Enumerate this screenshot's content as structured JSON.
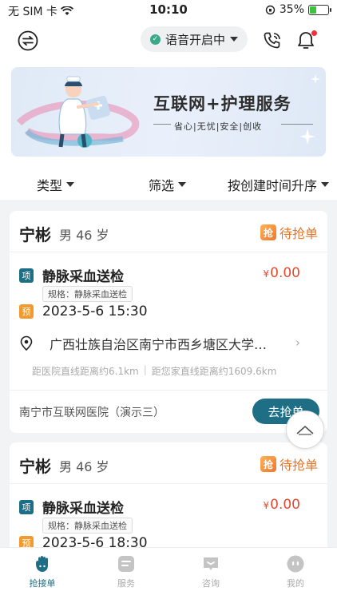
{
  "status_bar": {
    "carrier": "无 SIM 卡",
    "time": "10:10",
    "battery": "35%",
    "battery_fraction": 0.35
  },
  "header": {
    "voice_label": "语音开启中"
  },
  "banner": {
    "title": "互联网+护理服务",
    "subtitle": "省心|无忧|安全|创收"
  },
  "filters": [
    {
      "label": "类型"
    },
    {
      "label": "筛选"
    },
    {
      "label": "按创建时间升序"
    }
  ],
  "orders": [
    {
      "name": "宁彬",
      "gender_age": "男 46 岁",
      "status": "待抢单",
      "status_icon": "抢",
      "service_tag": "项",
      "service": "静脉采血送检",
      "price_symbol": "¥",
      "price": "0.00",
      "spec": "规格：静脉采血送检",
      "time_tag": "预",
      "datetime": "2023-5-6 15:30",
      "address": "广西壮族自治区南宁市西乡塘区大学…",
      "dist_hospital": "距医院直线距离约6.1km",
      "dist_home": "距您家直线距离约1609.6km",
      "hospital": "南宁市互联网医院（演示三）",
      "action": "去抢单"
    },
    {
      "name": "宁彬",
      "gender_age": "男 46 岁",
      "status": "待抢单",
      "status_icon": "抢",
      "service_tag": "项",
      "service": "静脉采血送检",
      "price_symbol": "¥",
      "price": "0.00",
      "spec": "规格：静脉采血送检",
      "time_tag": "预",
      "datetime": "2023-5-6 18:30"
    }
  ],
  "tabbar": [
    {
      "label": "抢接单",
      "icon": "hand-icon",
      "active": true
    },
    {
      "label": "服务",
      "icon": "service-icon",
      "active": false
    },
    {
      "label": "咨询",
      "icon": "chat-icon",
      "active": false
    },
    {
      "label": "我的",
      "icon": "profile-icon",
      "active": false
    }
  ],
  "colors": {
    "primary": "#1e6f86",
    "accent": "#e8752a",
    "price": "#e64a2e",
    "voice_dot": "#3aa88a"
  }
}
